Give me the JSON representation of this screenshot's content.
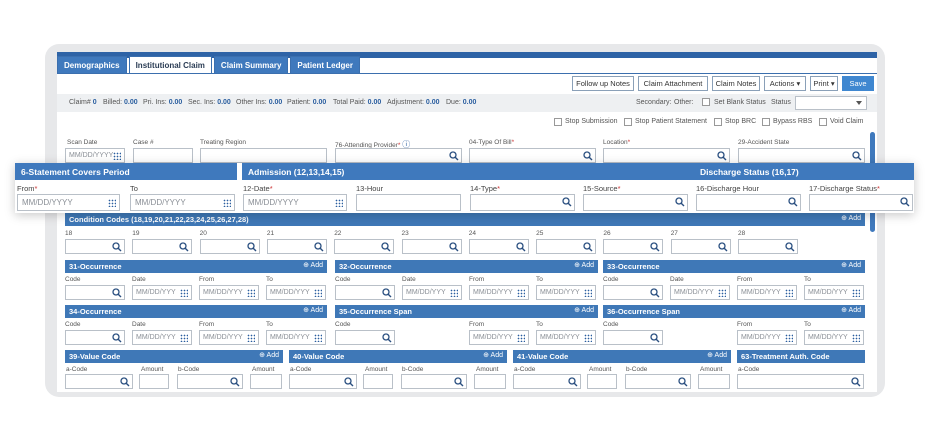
{
  "tabs": [
    "Demographics",
    "Institutional Claim",
    "Claim Summary",
    "Patient Ledger"
  ],
  "toolbar": {
    "follow": "Follow up Notes",
    "attach": "Claim Attachment",
    "notes": "Claim Notes",
    "actions": "Actions",
    "print": "Print",
    "save": "Save"
  },
  "summary": {
    "claim_label": "Claim#",
    "claim": "0",
    "billed_label": "Billed:",
    "billed": "0.00",
    "pri_label": "Pri. Ins:",
    "pri": "0.00",
    "sec_label": "Sec. Ins:",
    "sec": "0.00",
    "other_label": "Other Ins:",
    "other": "0.00",
    "patient_label": "Patient:",
    "patient": "0.00",
    "paid_label": "Total Paid:",
    "paid": "0.00",
    "adj_label": "Adjustment:",
    "adj": "0.00",
    "due_label": "Due:",
    "due": "0.00",
    "secondary": "Secondary:",
    "other2": "Other:",
    "blank": "Set Blank Status",
    "status": "Status"
  },
  "checks": [
    "Stop Submission",
    "Stop Patient Statement",
    "Stop BRC",
    "Bypass RBS",
    "Void Claim"
  ],
  "fields": {
    "scan": "Scan Date",
    "case": "Case #",
    "region": "Treating Region",
    "prov": "76-Attending Provider",
    "bill": "04-Type Of Bill",
    "loc": "Location",
    "state": "29-Accident State",
    "date_ph": "MM/DD/YYYY",
    "date_ph_short": "MM/DD/YYY"
  },
  "callout": {
    "sect1": "6-Statement Covers Period",
    "sect2": "Admission (12,13,14,15)",
    "sect3": "Discharge Status (16,17)",
    "from": "From",
    "to": "To",
    "date12": "12-Date",
    "hour13": "13-Hour",
    "type14": "14-Type",
    "src15": "15-Source",
    "dh16": "16-Discharge Hour",
    "ds17": "17-Discharge Status",
    "ph": "MM/DD/YYYY"
  },
  "cond": {
    "title": "Condition Codes (18,19,20,21,22,23,24,25,26,27,28)",
    "add": "⊕ Add",
    "nums": [
      "18",
      "19",
      "20",
      "21",
      "22",
      "23",
      "24",
      "25",
      "26",
      "27",
      "28"
    ]
  },
  "occ": {
    "o31": "31-Occurrence",
    "o32": "32-Occurrence",
    "o33": "33-Occurrence",
    "o34": "34-Occurrence",
    "o35": "35-Occurrence Span",
    "o36": "36-Occurrence Span",
    "code": "Code",
    "date": "Date",
    "from": "From",
    "to": "To",
    "add": "⊕ Add"
  },
  "val": {
    "v39": "39-Value Code",
    "v40": "40-Value Code",
    "v41": "41-Value Code",
    "v63": "63-Treatment Auth. Code",
    "acode": "a-Code",
    "amount": "Amount",
    "bcode": "b-Code",
    "add": "⊕ Add"
  }
}
